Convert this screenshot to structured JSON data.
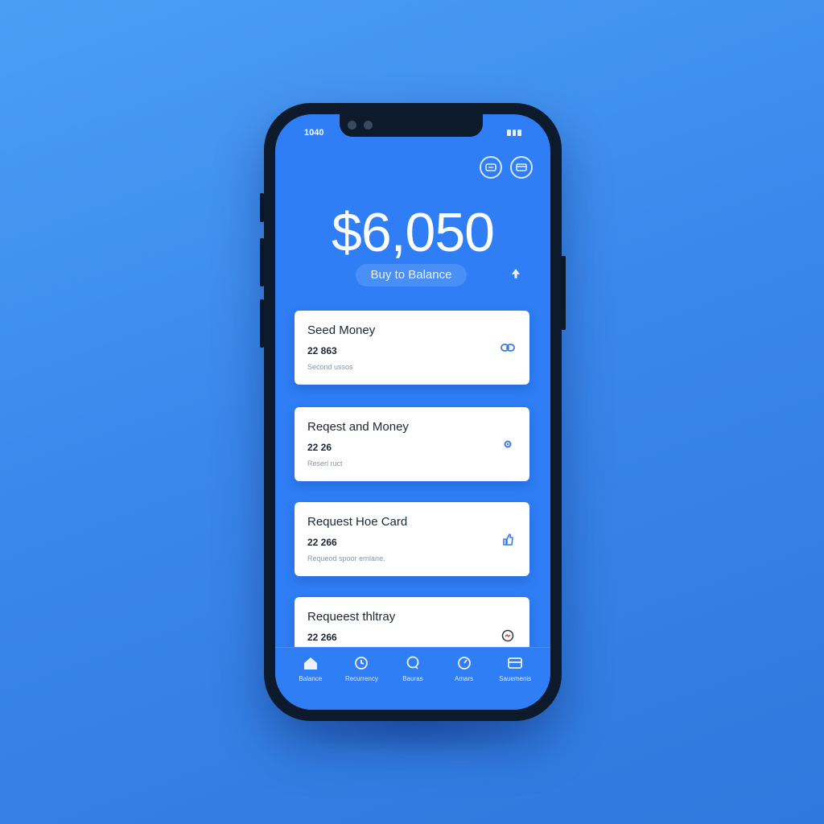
{
  "status": {
    "time": "1040"
  },
  "header": {
    "left_icon": "wallet-icon",
    "right_icon": "card-icon"
  },
  "balance": {
    "amount": "$6,050",
    "action_label": "Buy to Balance",
    "action_icon": "arrow-up-icon"
  },
  "cards": [
    {
      "title": "Seed Money",
      "amount": "22 863",
      "note": "Second ussos",
      "icon": "link-icon"
    },
    {
      "title": "Reqest and Money",
      "amount": "22 26",
      "note": "Reserl ruct",
      "icon": "gear-icon"
    },
    {
      "title": "Request Hoe Card",
      "amount": "22 266",
      "note": "Requeod spoor ernlane.",
      "icon": "thumbs-up-icon"
    },
    {
      "title": "Requeest thltray",
      "amount": "22 266",
      "note": "",
      "icon": "clock-icon"
    }
  ],
  "tabs": [
    {
      "label": "Balance",
      "icon": "home-icon"
    },
    {
      "label": "Recurrency",
      "icon": "clock-icon"
    },
    {
      "label": "Bauras",
      "icon": "chat-icon"
    },
    {
      "label": "Amars",
      "icon": "gauge-icon"
    },
    {
      "label": "Sauemenis",
      "icon": "card-icon"
    }
  ],
  "colors": {
    "background": "#3a88ec",
    "screen": "#2f7ef5",
    "frame": "#0d1a2c",
    "card": "#ffffff",
    "icon_accent": "#3f78e6"
  }
}
